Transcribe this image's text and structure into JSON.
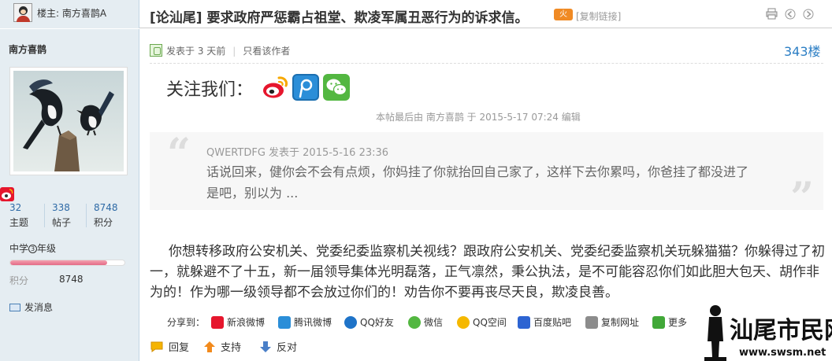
{
  "op": {
    "label": "楼主: 南方喜鹊A"
  },
  "thread": {
    "title": "[论汕尾] 要求政府严惩霸占祖堂、欺凌军属丑恶行为的诉求信。",
    "hot": "火",
    "copy_link": "[复制链接]"
  },
  "author": {
    "name": "南方喜鹊",
    "stats": [
      {
        "num": "32",
        "label": "主题"
      },
      {
        "num": "338",
        "label": "帖子"
      },
      {
        "num": "8748",
        "label": "积分"
      }
    ],
    "level": {
      "prefix": "中学",
      "badge": "3",
      "suffix": "年级",
      "progress": 0.85
    },
    "points_key": "积分",
    "points_value": "8748",
    "send_message": "发消息"
  },
  "post": {
    "meta_posted": "发表于 3 天前",
    "meta_only_author": "只看该作者",
    "floor": "343楼",
    "follow_text": "关注我们：",
    "edit_note": "本帖最后由 南方喜鹊 于 2015-5-17 07:24 编辑",
    "quote_head": "QWERTDFG 发表于 2015-5-16 23:36",
    "quote_body": "话说回来，健你会不会有点烦，你妈挂了你就抬回自己家了，这样下去你累吗，你爸挂了都没进了是吧，别以为 ...",
    "body": "你想转移政府公安机关、党委纪委监察机关视线？跟政府公安机关、党委纪委监察机关玩躲猫猫？你躲得过了初一，就躲避不了十五，新一届领导集体光明磊落，正气凛然，秉公执法，是不可能容忍你们如此胆大包天、胡作非为的！作为哪一级领导都不会放过你们的！劝告你不要再丧尽天良，欺凌良善。"
  },
  "share": {
    "label": "分享到：",
    "items": [
      {
        "label": "新浪微博",
        "color": "#e6162d"
      },
      {
        "label": "腾讯微博",
        "color": "#2b8ed8"
      },
      {
        "label": "QQ好友",
        "color": "#1e73c8"
      },
      {
        "label": "微信",
        "color": "#53b741"
      },
      {
        "label": "QQ空间",
        "color": "#f5b800"
      },
      {
        "label": "百度贴吧",
        "color": "#2d64d2"
      },
      {
        "label": "复制网址",
        "color": "#8c8c8c"
      },
      {
        "label": "更多",
        "color": "#41a838"
      }
    ]
  },
  "actions": {
    "reply": "回复",
    "support": "支持",
    "oppose": "反对"
  },
  "watermark": {
    "title": "汕尾市民网",
    "url": "www.swsm.net"
  }
}
